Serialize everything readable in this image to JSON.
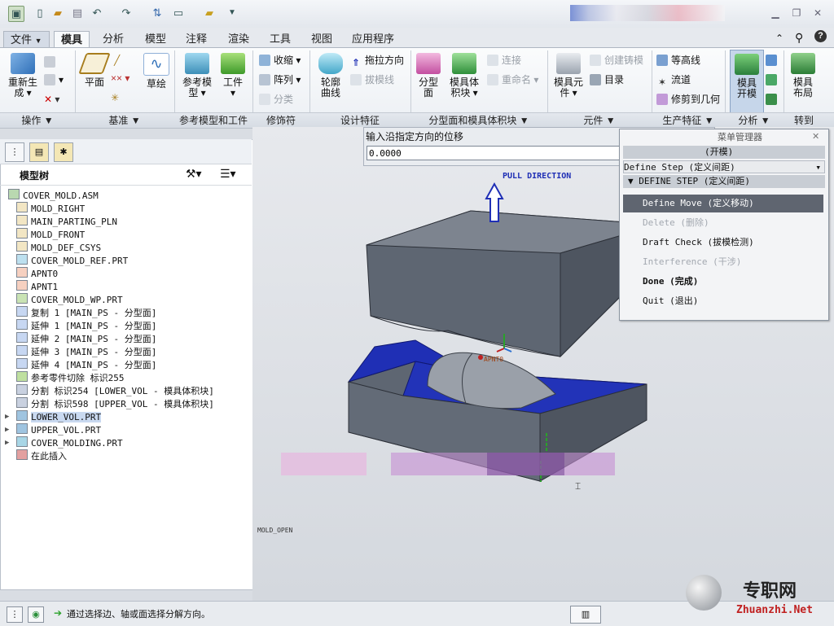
{
  "quick_access": {
    "icons": [
      "new-icon",
      "open-icon",
      "save-icon",
      "undo-icon",
      "redo-icon",
      "regenerate-icon",
      "windows-icon",
      "close-window-icon",
      "customize-icon"
    ]
  },
  "tabs": [
    {
      "label": "文件",
      "dropdown": "▼"
    },
    {
      "label": "模具"
    },
    {
      "label": "分析"
    },
    {
      "label": "模型"
    },
    {
      "label": "注释"
    },
    {
      "label": "渲染"
    },
    {
      "label": "工具"
    },
    {
      "label": "视图"
    },
    {
      "label": "应用程序"
    }
  ],
  "ribbon": {
    "regen": "重新生",
    "regen2": "成",
    "plane": "平面",
    "sketch": "草绘",
    "ref_model": "参考模",
    "ref_model2": "型",
    "workpiece": "工件",
    "shrink": "收缩",
    "pattern": "阵列",
    "classify": "分类",
    "silhouette": "轮廓",
    "silhouette2": "曲线",
    "drag_dir": "拖拉方向",
    "draft_line": "拔模线",
    "parting": "分型",
    "parting2": "面",
    "mold_vol": "模具体",
    "mold_vol2": "积块",
    "connect": "连接",
    "rename": "重命名",
    "mold_comp": "模具元",
    "mold_comp2": "件",
    "create_casting": "创建铸模",
    "catalog": "目录",
    "contour": "等高线",
    "runner": "流道",
    "trim_geom": "修剪到几何",
    "mold_open": "模具",
    "mold_open2": "开模",
    "mold_layout": "模具",
    "mold_layout2": "布局"
  },
  "groups": [
    "操作 ▼",
    "基准 ▼",
    "参考模型和工件",
    "修饰符",
    "设计特征",
    "分型面和模具体积块 ▼",
    "元件 ▼",
    "生产特征 ▼",
    "分析 ▼",
    "转到"
  ],
  "model_tree": {
    "title": "模型树",
    "items": [
      {
        "label": "COVER_MOLD.ASM",
        "icon": "assembly-icon",
        "indent": 0
      },
      {
        "label": "MOLD_RIGHT",
        "icon": "datum-plane-icon",
        "indent": 1
      },
      {
        "label": "MAIN_PARTING_PLN",
        "icon": "datum-plane-icon",
        "indent": 1
      },
      {
        "label": "MOLD_FRONT",
        "icon": "datum-plane-icon",
        "indent": 1
      },
      {
        "label": "MOLD_DEF_CSYS",
        "icon": "csys-icon",
        "indent": 1
      },
      {
        "label": "COVER_MOLD_REF.PRT",
        "icon": "part-icon",
        "indent": 1
      },
      {
        "label": "APNT0",
        "icon": "datum-point-icon",
        "indent": 1
      },
      {
        "label": "APNT1",
        "icon": "datum-point-icon",
        "indent": 1
      },
      {
        "label": "COVER_MOLD_WP.PRT",
        "icon": "workpiece-icon",
        "indent": 1
      },
      {
        "label": "复制 1 [MAIN_PS - 分型面]",
        "icon": "surface-icon",
        "indent": 1
      },
      {
        "label": "延伸 1 [MAIN_PS - 分型面]",
        "icon": "surface-icon",
        "indent": 1
      },
      {
        "label": "延伸 2 [MAIN_PS - 分型面]",
        "icon": "surface-icon",
        "indent": 1
      },
      {
        "label": "延伸 3 [MAIN_PS - 分型面]",
        "icon": "surface-icon",
        "indent": 1
      },
      {
        "label": "延伸 4 [MAIN_PS - 分型面]",
        "icon": "surface-icon",
        "indent": 1
      },
      {
        "label": "参考零件切除 标识255",
        "icon": "cut-icon",
        "indent": 1
      },
      {
        "label": "分割 标识254 [LOWER_VOL - 模具体积块]",
        "icon": "split-icon",
        "indent": 1
      },
      {
        "label": "分割 标识598 [UPPER_VOL - 模具体积块]",
        "icon": "split-icon",
        "indent": 1
      },
      {
        "label": "LOWER_VOL.PRT",
        "icon": "volume-icon",
        "indent": 1,
        "expand": "▶",
        "selected": true
      },
      {
        "label": "UPPER_VOL.PRT",
        "icon": "volume-icon",
        "indent": 1,
        "expand": "▶"
      },
      {
        "label": "COVER_MOLDING.PRT",
        "icon": "molding-icon",
        "indent": 1,
        "expand": "▶"
      },
      {
        "label": "在此插入",
        "icon": "insert-arrow-icon",
        "indent": 1
      }
    ]
  },
  "input": {
    "prompt": "输入沿指定方向的位移",
    "value": "0.0000"
  },
  "menu_manager": {
    "title": "菜单管理器",
    "row1": "(开模)",
    "row2": "Define Step (定义间距)",
    "header": "DEFINE STEP (定义间距)",
    "items": [
      {
        "label": "Define Move (定义移动)",
        "state": "selected"
      },
      {
        "label": "Delete (删除)",
        "state": "disabled"
      },
      {
        "label": "Draft Check (拔模检测)",
        "state": "normal"
      },
      {
        "label": "Interference (干涉)",
        "state": "disabled"
      },
      {
        "label": "Done (完成)",
        "state": "bold"
      },
      {
        "label": "Quit (退出)",
        "state": "normal"
      }
    ]
  },
  "viewport": {
    "pull_direction": "PULL DIRECTION",
    "point_label": "APNT0",
    "model_label": "MOLD_OPEN"
  },
  "status": {
    "message": "通过选择边、轴或面选择分解方向。"
  },
  "watermark": {
    "cn": "专职网",
    "en": "Zhuanzhi.Net"
  },
  "colors": {
    "accent_blue": "#1f2fb5",
    "mold_grey": "#5f6673",
    "check_green": "#2aa12a"
  }
}
